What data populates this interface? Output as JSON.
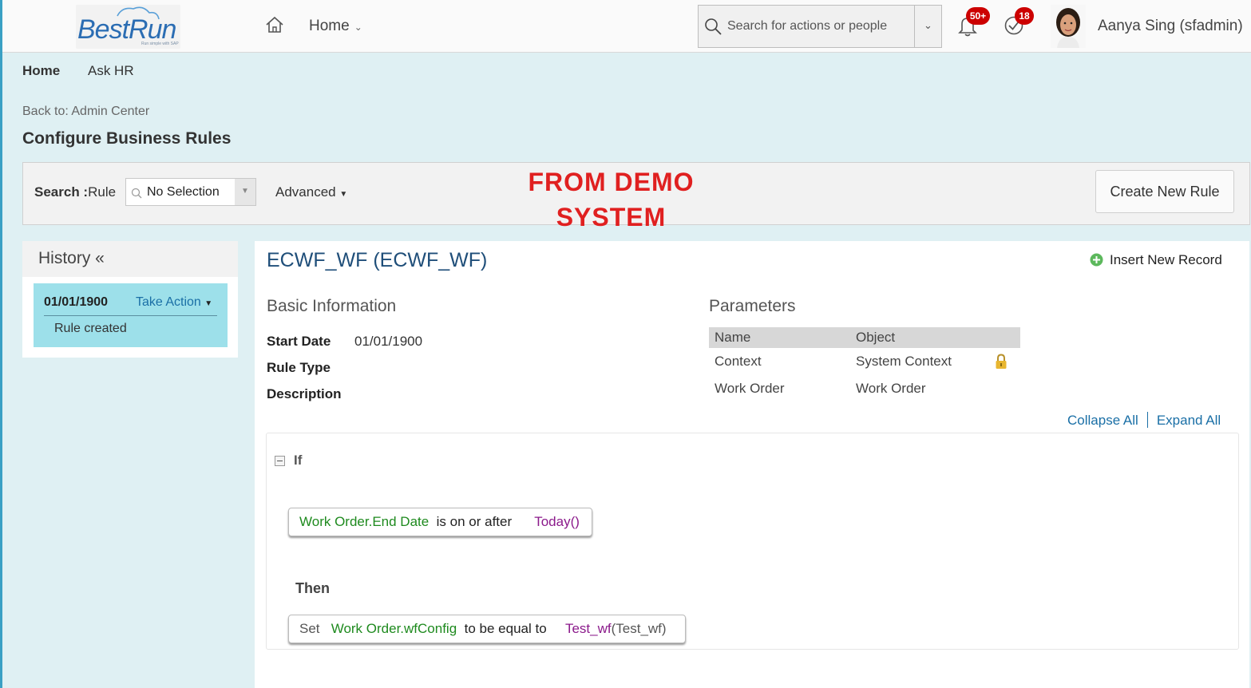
{
  "brand": {
    "name": "BestRun",
    "tagline": "Run simple with SAP"
  },
  "shell": {
    "home_label": "Home",
    "search_placeholder": "Search for actions or people",
    "notifications_count": "50+",
    "todo_count": "18",
    "user_name": "Aanya Sing (sfadmin)"
  },
  "subnav": {
    "items": [
      "Home",
      "Ask HR"
    ]
  },
  "breadcrumb": {
    "back": "Back to: Admin Center"
  },
  "page": {
    "title": "Configure Business Rules"
  },
  "search": {
    "label_bold": "Search :",
    "label": "Rule",
    "selected": "No Selection",
    "advanced": "Advanced",
    "create_button": "Create New Rule"
  },
  "watermark": {
    "line1": "FROM DEMO",
    "line2": "SYSTEM"
  },
  "history": {
    "title": "History «",
    "entries": [
      {
        "date": "01/01/1900",
        "action": "Take Action",
        "note": "Rule created"
      }
    ]
  },
  "rule": {
    "title": "ECWF_WF (ECWF_WF)",
    "insert_label": "Insert New Record",
    "basic_info": {
      "heading": "Basic Information",
      "start_date_label": "Start Date",
      "start_date": "01/01/1900",
      "rule_type_label": "Rule Type",
      "description_label": "Description"
    },
    "parameters": {
      "heading": "Parameters",
      "columns": [
        "Name",
        "Object"
      ],
      "rows": [
        [
          "Context",
          "System Context"
        ],
        [
          "Work Order",
          "Work Order"
        ]
      ]
    },
    "collapse_all": "Collapse All",
    "expand_all": "Expand All",
    "if_label": "If",
    "then_label": "Then",
    "condition": {
      "field": "Work Order.End Date",
      "operator": "is on or after",
      "value": "Today()"
    },
    "action": {
      "verb": "Set",
      "field": "Work Order.wfConfig",
      "operator": "to be equal to",
      "value": "Test_wf",
      "value_suffix": "(Test_wf)"
    }
  },
  "colors": {
    "brand_blue": "#2b6db3",
    "link": "#1a6fa6",
    "badge": "#cc0000",
    "history_card": "#9de0ea",
    "watermark": "#e02020"
  }
}
